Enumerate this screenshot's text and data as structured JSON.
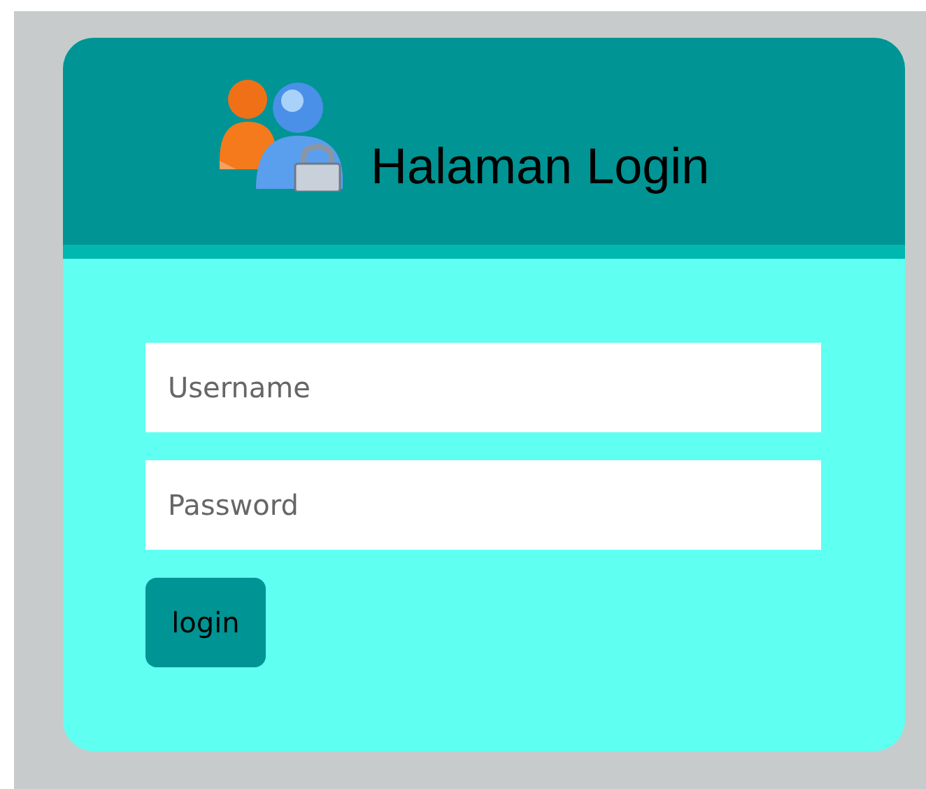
{
  "header": {
    "title": "Halaman Login"
  },
  "form": {
    "fields": [
      {
        "placeholder": "Username"
      },
      {
        "placeholder": "Password"
      }
    ],
    "button": "login"
  }
}
